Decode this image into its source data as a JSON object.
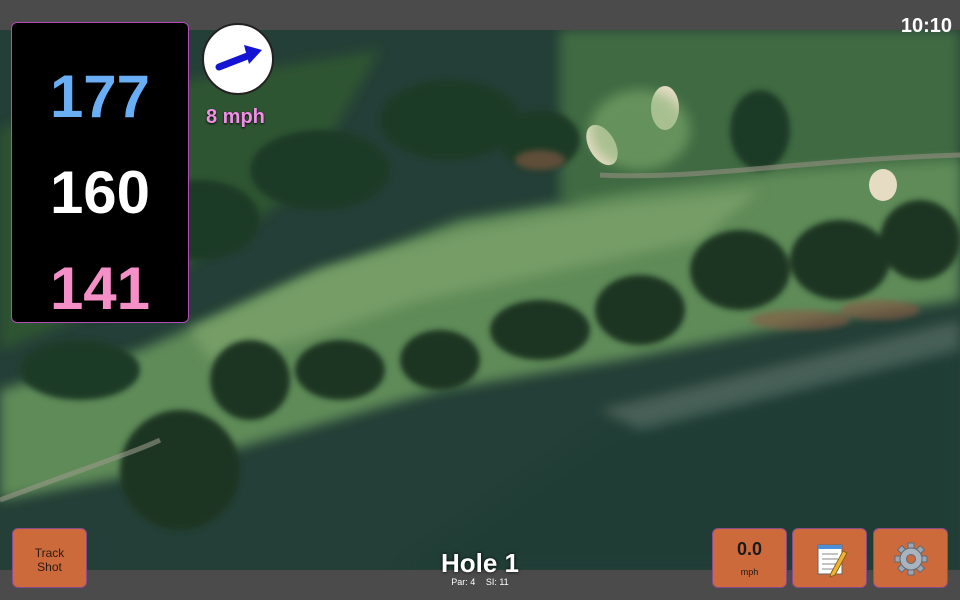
{
  "status": {
    "time": "10:10"
  },
  "distances": {
    "back": "177",
    "middle": "160",
    "front": "141"
  },
  "wind": {
    "speed": "8 mph",
    "icon": "wind-arrow-icon"
  },
  "buttons": {
    "track_shot_line1": "Track",
    "track_shot_line2": "Shot",
    "speed_value": "0.0",
    "speed_unit": "mph",
    "notes_icon": "notepad-icon",
    "settings_icon": "gear-icon"
  },
  "hole": {
    "title": "Hole 1",
    "par": "Par: 4",
    "si": "SI: 11"
  },
  "colors": {
    "back": "#6aaef5",
    "middle": "#ffffff",
    "front": "#f58fc8",
    "wind_text": "#f28ee8",
    "button": "#cd6a3c",
    "arrow": "#1414d4"
  }
}
